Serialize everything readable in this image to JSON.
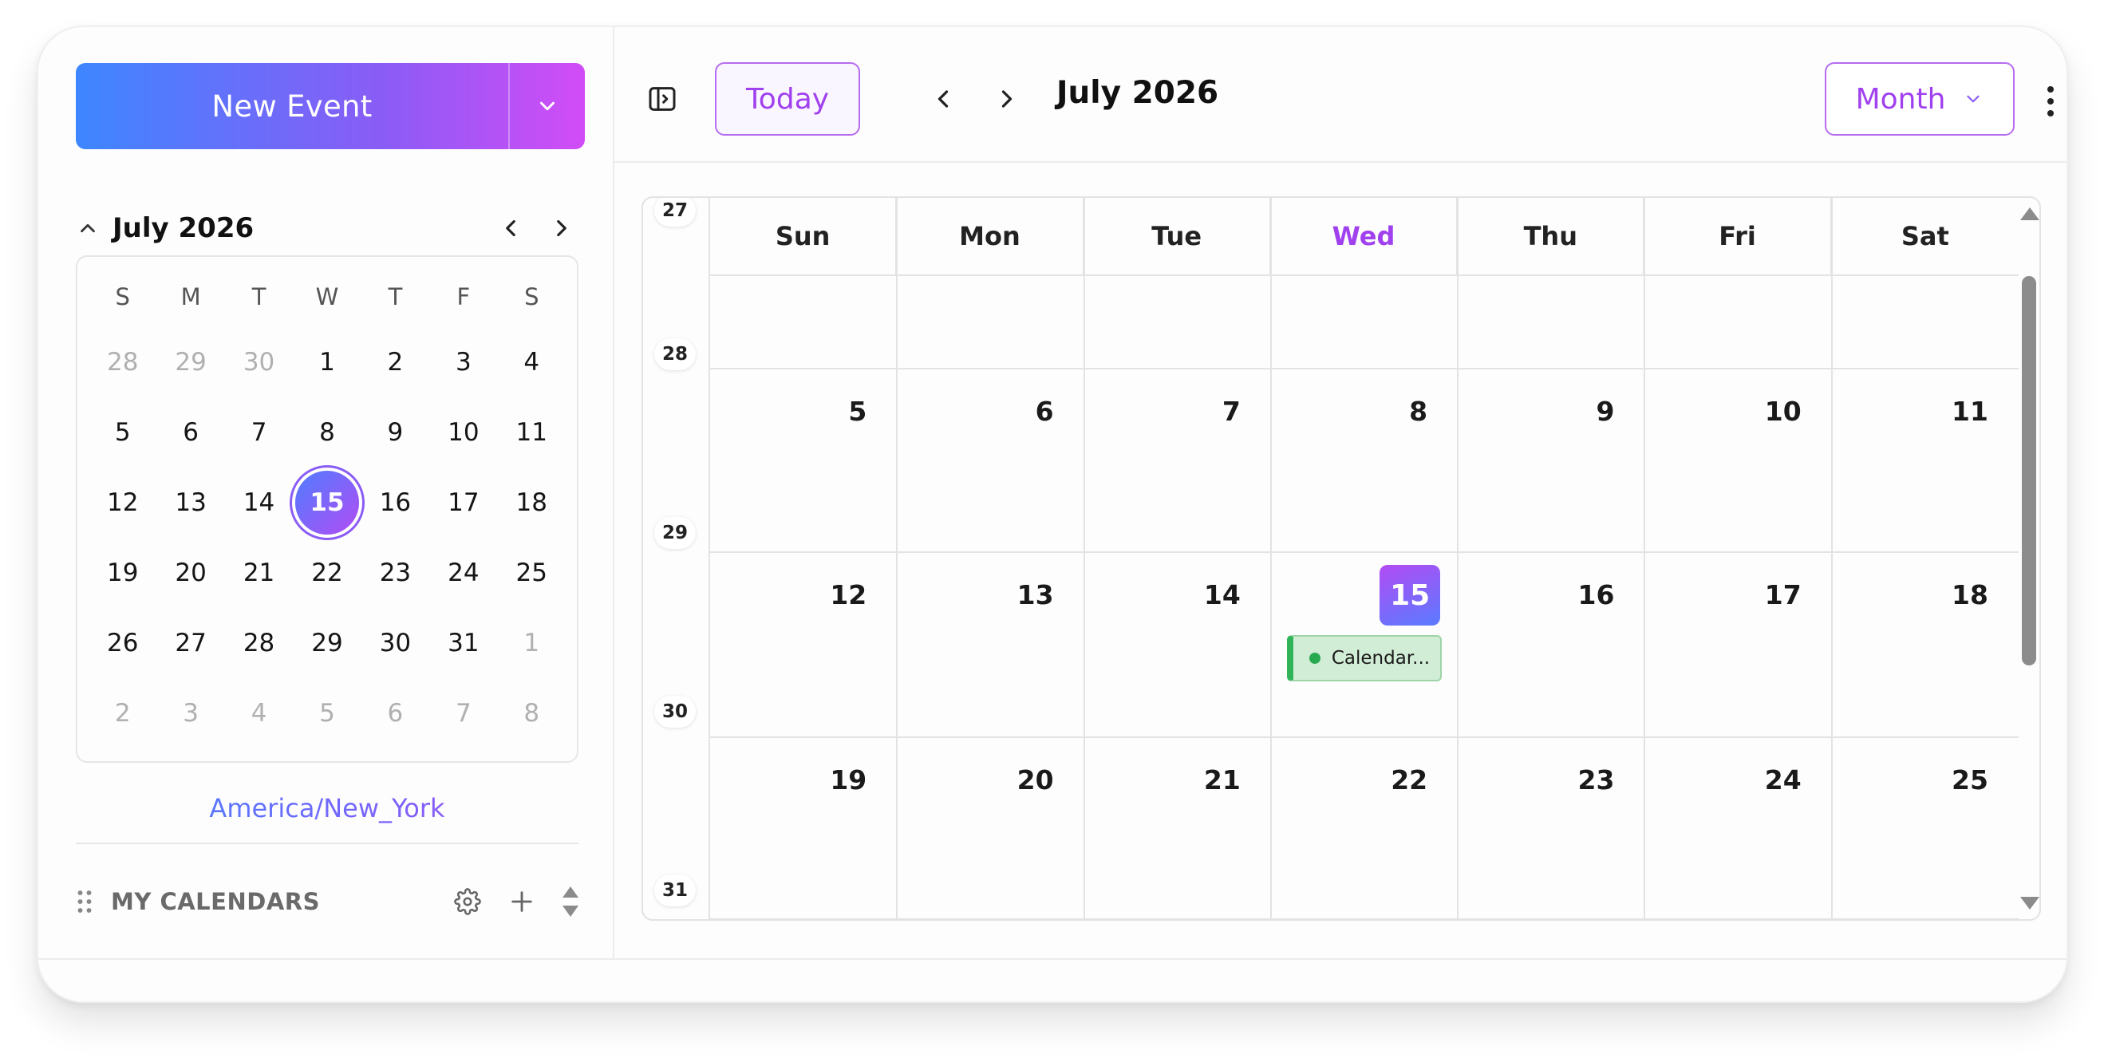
{
  "sidebar": {
    "new_event_label": "New Event",
    "mini_calendar": {
      "title": "July 2026",
      "weekdays": [
        "S",
        "M",
        "T",
        "W",
        "T",
        "F",
        "S"
      ],
      "selected_day": "15"
    },
    "timezone": "America/New_York",
    "my_calendars_label": "MY CALENDARS"
  },
  "toolbar": {
    "today_label": "Today",
    "title": "July 2026",
    "view_label": "Month"
  },
  "month_view": {
    "weekday_headers": [
      "Sun",
      "Mon",
      "Tue",
      "Wed",
      "Thu",
      "Fri",
      "Sat"
    ],
    "today_header": "Wed",
    "week_numbers": [
      "27",
      "28",
      "29",
      "30",
      "31"
    ],
    "weeks": [
      [
        "",
        "",
        "",
        "",
        "",
        "",
        ""
      ],
      [
        "5",
        "6",
        "7",
        "8",
        "9",
        "10",
        "11"
      ],
      [
        "12",
        "13",
        "14",
        "15",
        "16",
        "17",
        "18"
      ],
      [
        "19",
        "20",
        "21",
        "22",
        "23",
        "24",
        "25"
      ]
    ],
    "today_date": "15",
    "events": [
      {
        "title": "Calendar...",
        "color": "#2fb45a"
      }
    ]
  },
  "colors": {
    "accent": "#a040ee",
    "gradient_start": "#3d86ff",
    "gradient_end": "#d24cf6",
    "event_green": "#2fb45a"
  },
  "icons": {
    "dropdown": "chevron-down-icon",
    "collapse": "chevron-up-icon",
    "prev": "chevron-left-icon",
    "next": "chevron-right-icon",
    "sidebar_toggle": "sidebar-toggle-icon",
    "menu": "more-vertical-icon",
    "settings": "gear-icon",
    "add": "plus-icon",
    "drag": "drag-handle-icon"
  }
}
